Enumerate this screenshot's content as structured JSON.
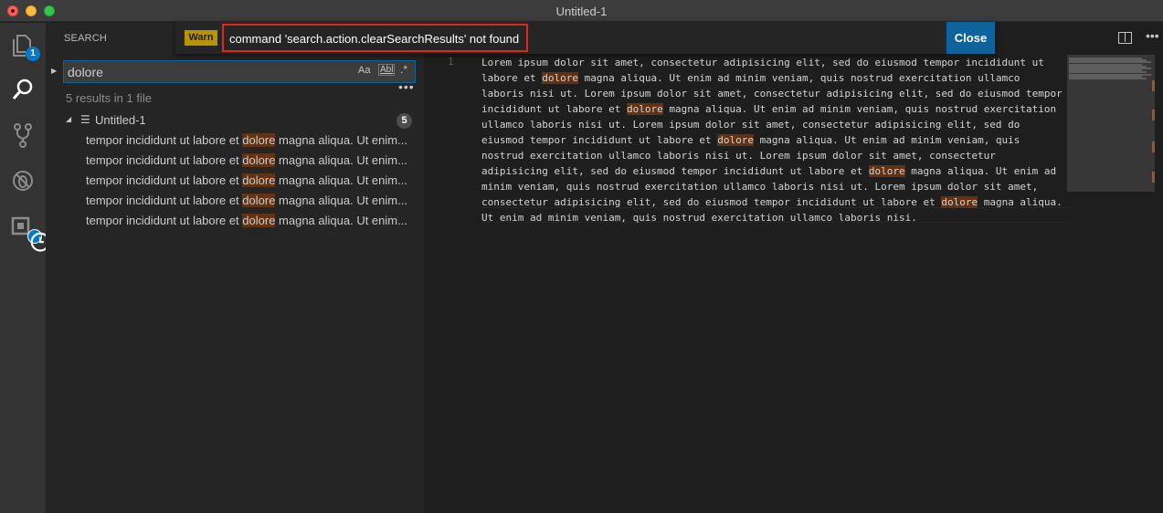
{
  "window": {
    "title": "Untitled-1"
  },
  "activity": {
    "explorer_badge": "1"
  },
  "sidebar": {
    "title": "SEARCH",
    "search_value": "dolore",
    "opt_case": "Aa",
    "opt_word": "Abl",
    "opt_regex": ".*",
    "more": "•••",
    "summary": "5 results in 1 file",
    "file": {
      "name": "Untitled-1",
      "count": "5"
    },
    "matches": [
      {
        "before": "tempor incididunt ut labore et ",
        "match": "dolore",
        "after": " magna aliqua. Ut enim..."
      },
      {
        "before": "tempor incididunt ut labore et ",
        "match": "dolore",
        "after": " magna aliqua. Ut enim..."
      },
      {
        "before": "tempor incididunt ut labore et ",
        "match": "dolore",
        "after": " magna aliqua. Ut enim..."
      },
      {
        "before": "tempor incididunt ut labore et ",
        "match": "dolore",
        "after": " magna aliqua. Ut enim..."
      },
      {
        "before": "tempor incididunt ut labore et ",
        "match": "dolore",
        "after": " magna aliqua. Ut enim..."
      }
    ]
  },
  "notification": {
    "severity": "Warn",
    "message": "command 'search.action.clearSearchResults' not found",
    "close_label": "Close"
  },
  "editor": {
    "line_number": "1",
    "lines": [
      [
        {
          "t": "Lorem ipsum dolor sit amet, consectetur adipisicing elit, sed do eiusmod tempor incididunt ut"
        }
      ],
      [
        {
          "t": "labore et "
        },
        {
          "t": "dolore",
          "hl": true
        },
        {
          "t": " magna aliqua. Ut enim ad minim veniam, quis nostrud exercitation ullamco"
        }
      ],
      [
        {
          "t": "laboris nisi ut. Lorem ipsum dolor sit amet, consectetur adipisicing elit, sed do eiusmod tempor"
        }
      ],
      [
        {
          "t": "incididunt ut labore et "
        },
        {
          "t": "dolore",
          "hl": true
        },
        {
          "t": " magna aliqua. Ut enim ad minim veniam, quis nostrud exercitation"
        }
      ],
      [
        {
          "t": "ullamco laboris nisi ut. Lorem ipsum dolor sit amet, consectetur adipisicing elit, sed do"
        }
      ],
      [
        {
          "t": "eiusmod tempor incididunt ut labore et "
        },
        {
          "t": "dolore",
          "hl": true
        },
        {
          "t": " magna aliqua. Ut enim ad minim veniam, quis"
        }
      ],
      [
        {
          "t": "nostrud exercitation ullamco laboris nisi ut. Lorem ipsum dolor sit amet, consectetur"
        }
      ],
      [
        {
          "t": "adipisicing elit, sed do eiusmod tempor incididunt ut labore et "
        },
        {
          "t": "dolore",
          "hl": true
        },
        {
          "t": " magna aliqua. Ut enim ad"
        }
      ],
      [
        {
          "t": "minim veniam, quis nostrud exercitation ullamco laboris nisi ut. Lorem ipsum dolor sit amet,"
        }
      ],
      [
        {
          "t": "consectetur adipisicing elit, sed do eiusmod tempor incididunt ut labore et "
        },
        {
          "t": "dolore",
          "hl": true
        },
        {
          "t": " magna aliqua."
        }
      ],
      [
        {
          "t": "Ut enim ad minim veniam, quis nostrud exercitation ullamco laboris nisi."
        }
      ]
    ]
  },
  "colors": {
    "accent": "#007acc",
    "warn": "#b89500",
    "match_highlight": "#613214",
    "error_outline": "#e3251b"
  }
}
